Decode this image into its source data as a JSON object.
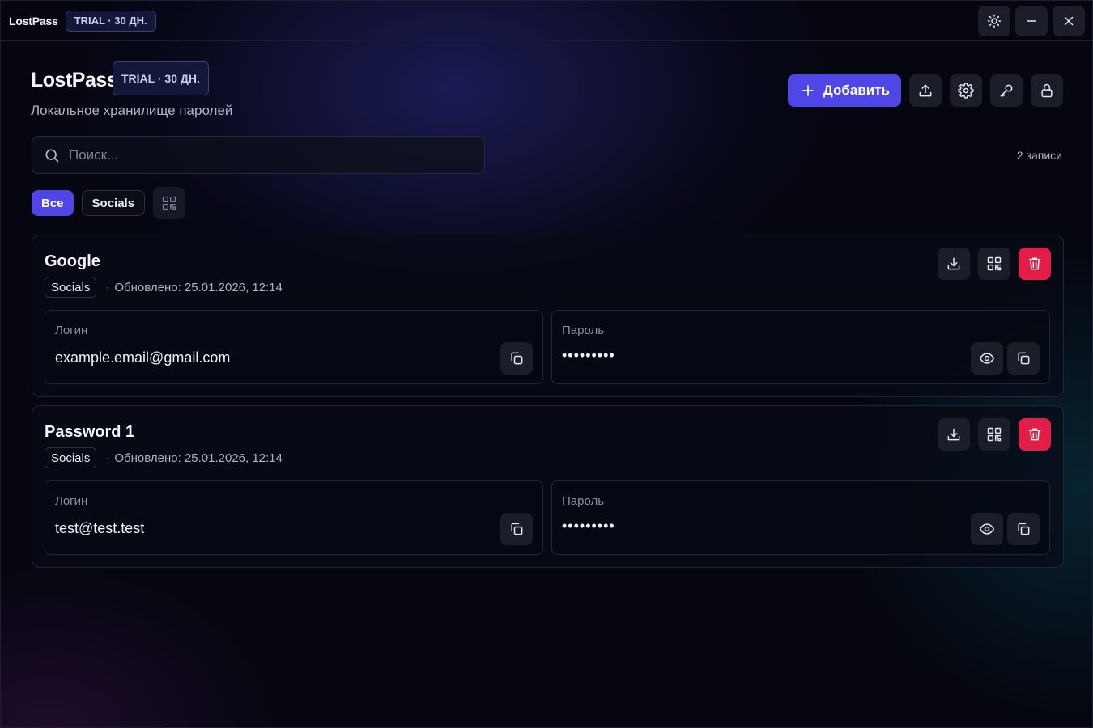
{
  "window": {
    "app_name": "LostPass",
    "trial_badge": "TRIAL · 30 ДН."
  },
  "header": {
    "title": "LostPass",
    "trial_badge": "TRIAL · 30 ДН.",
    "subtitle": "Локальное хранилище паролей",
    "add_label": "Добавить"
  },
  "search": {
    "placeholder": "Поиск...",
    "value": ""
  },
  "record_count": "2 записи",
  "filters": [
    {
      "label": "Все",
      "active": true
    },
    {
      "label": "Socials",
      "active": false
    }
  ],
  "entries": [
    {
      "title": "Google",
      "tag": "Socials",
      "updated": "Обновлено: 25.01.2026, 12:14",
      "login_label": "Логин",
      "login": "example.email@gmail.com",
      "password_label": "Пароль",
      "password": "•••••••••"
    },
    {
      "title": "Password 1",
      "tag": "Socials",
      "updated": "Обновлено: 25.01.2026, 12:14",
      "login_label": "Логин",
      "login": "test@test.test",
      "password_label": "Пароль",
      "password": "•••••••••"
    }
  ],
  "colors": {
    "accent": "#4f46e5",
    "danger": "#e11d48",
    "background": "#05060f"
  }
}
